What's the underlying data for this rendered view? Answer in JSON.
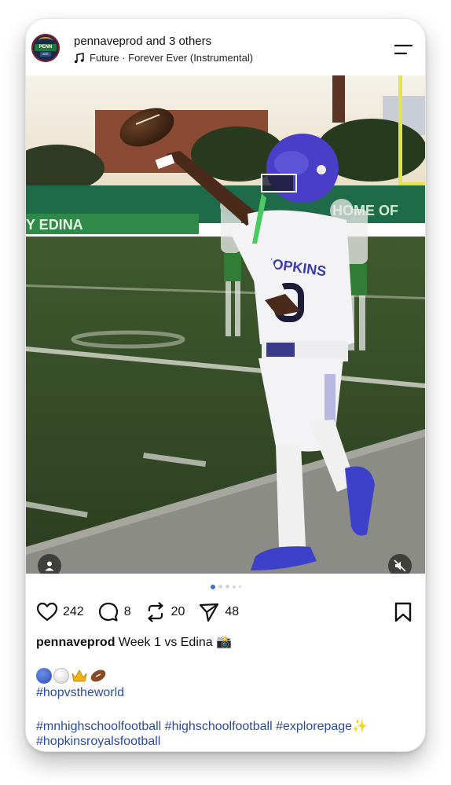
{
  "header": {
    "username": "pennaveprod",
    "coauthors": " and 3 others",
    "music": "Future · Forever Ever (Instrumental)",
    "avatar_text_top": "PENN",
    "avatar_text_bottom": "AVE"
  },
  "actions": {
    "likes": "242",
    "comments": "8",
    "reposts": "20",
    "shares": "48"
  },
  "carousel": {
    "count": 5,
    "active_index": 0
  },
  "caption": {
    "username": "pennaveprod",
    "text": " Week 1 vs Edina 📸",
    "emojis": [
      "🔵",
      "⚪",
      "👑",
      "🏈"
    ],
    "hashtag_line1": "#hopvstheworld",
    "hashtag_line2": "#mnhighschoolfootball #highschoolfootball #explorepage",
    "hashtag_line2_suffix": "✨",
    "hashtag_line3": "#hopkinsroyalsfootball"
  },
  "photo": {
    "jersey_text": "HOPKINS",
    "banner_text": "Y EDINA",
    "wall_text": "HOME OF"
  },
  "colors": {
    "accent_blue": "#3d6fd9",
    "hashtag_blue": "#2a4c9a",
    "helmet_purple": "#4a3ec8"
  }
}
